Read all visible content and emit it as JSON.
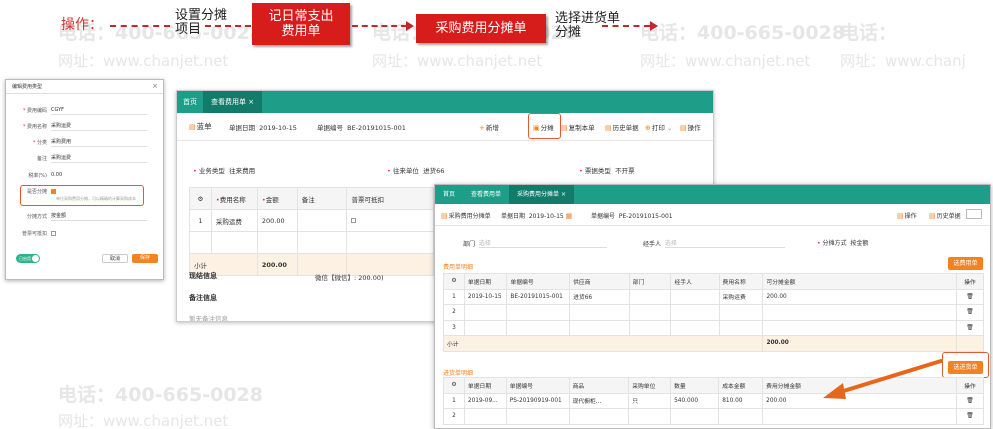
{
  "watermark": {
    "phone": "电话：400-665-0028",
    "site": "网址：www.chanjet.net",
    "phone_short": "电话：",
    "site_short": "网址：www.chanj"
  },
  "flow": {
    "label": "操作：",
    "step1": "设置分摊\n项目",
    "step2": "记日常支出\n费用单",
    "step3": "采购费用分摊单",
    "step4": "选择进货单\n分摊",
    "accent": "#d71c1c"
  },
  "dialog": {
    "title": "编辑费用类型",
    "close": "×",
    "fields": [
      {
        "label": "费用编码",
        "value": "CGYF",
        "required": true
      },
      {
        "label": "费用名称",
        "value": "采购运费",
        "required": true
      },
      {
        "label": "分类",
        "value": "采购费用",
        "required": true
      },
      {
        "label": "备注",
        "value": "采购运费",
        "required": false
      },
      {
        "label": "税率(%)",
        "value": "0.00",
        "required": false
      }
    ],
    "share_label": "是否分摊",
    "share_hint": "单位采购费用分摊，可以精确的计算采购成本",
    "method_label": "分摊方式",
    "method_value": "按金额",
    "invoice_label": "普票可抵扣",
    "toggle_label": "已启用",
    "cancel": "取消",
    "save": "保存"
  },
  "win1": {
    "tabs": [
      "首页",
      "查看费用单 ×"
    ],
    "doc_type": "蓝单",
    "date_label": "单据日期",
    "date_value": "2019-10-15",
    "no_label": "单据编号",
    "no_value": "BE-20191015-001",
    "toolbar": [
      "新增",
      "分摊",
      "复制本单",
      "历史单据",
      "打印",
      "操作"
    ],
    "biz_type_label": "业务类型",
    "biz_type_value": "往来费用",
    "partner_label": "往来单位",
    "partner_value": "进货66",
    "invoice_type_label": "票据类型",
    "invoice_type_value": "不开票",
    "table_headers": [
      "费用名称",
      "金额",
      "备注",
      "普票可抵扣"
    ],
    "rows": [
      {
        "idx": "1",
        "name": "采购运费",
        "amount": "200.00",
        "remark": "",
        "deduct": ""
      }
    ],
    "subtotal_label": "小计",
    "subtotal_value": "200.00",
    "settle_label": "现结信息",
    "settle_value": "微信【微信】: 200.00)",
    "remark_title": "备注信息",
    "remark_empty": "暂无备注信息"
  },
  "win2": {
    "tabs": [
      "首页",
      "查看费用单",
      "采购费用分摊单 ×"
    ],
    "doc_type": "采购费用分摊单",
    "date_label": "单据日期",
    "date_value": "2019-10-15",
    "no_label": "单据编号",
    "no_value": "PE-20191015-001",
    "toolbar": [
      "操作",
      "历史单据"
    ],
    "dept_label": "部门",
    "dept_placeholder": "选择",
    "handler_label": "经手人",
    "handler_placeholder": "选择",
    "method_label": "分摊方式",
    "method_value": "按金额",
    "expense_section": "费用单明细",
    "select_expense_btn": "选费用单",
    "expense_headers": [
      "单据日期",
      "单据编号",
      "供应商",
      "部门",
      "经手人",
      "费用名称",
      "可分摊金额",
      "操作"
    ],
    "expense_rows": [
      {
        "idx": "1",
        "date": "2019-10-15",
        "no": "BE-20191015-001",
        "supplier": "进货66",
        "dept": "",
        "handler": "",
        "fee": "采购运费",
        "amount": "200.00"
      },
      {
        "idx": "2",
        "date": "",
        "no": "",
        "supplier": "",
        "dept": "",
        "handler": "",
        "fee": "",
        "amount": ""
      },
      {
        "idx": "3",
        "date": "",
        "no": "",
        "supplier": "",
        "dept": "",
        "handler": "",
        "fee": "",
        "amount": ""
      }
    ],
    "expense_subtotal_label": "小计",
    "expense_subtotal_value": "200.00",
    "purchase_section": "进货单明细",
    "select_purchase_btn": "选进货单",
    "purchase_headers": [
      "单据日期",
      "单据编号",
      "商品",
      "采购单位",
      "数量",
      "成本金额",
      "费用分摊金额",
      "操作"
    ],
    "purchase_rows": [
      {
        "idx": "1",
        "date": "2019-09...",
        "no": "PS-20190919-001",
        "item": "现代橱柜...",
        "unit": "只",
        "qty": "540.000",
        "cost": "810.00",
        "share": "200.00"
      },
      {
        "idx": "2",
        "date": "",
        "no": "",
        "item": "",
        "unit": "",
        "qty": "",
        "cost": "",
        "share": ""
      }
    ]
  }
}
